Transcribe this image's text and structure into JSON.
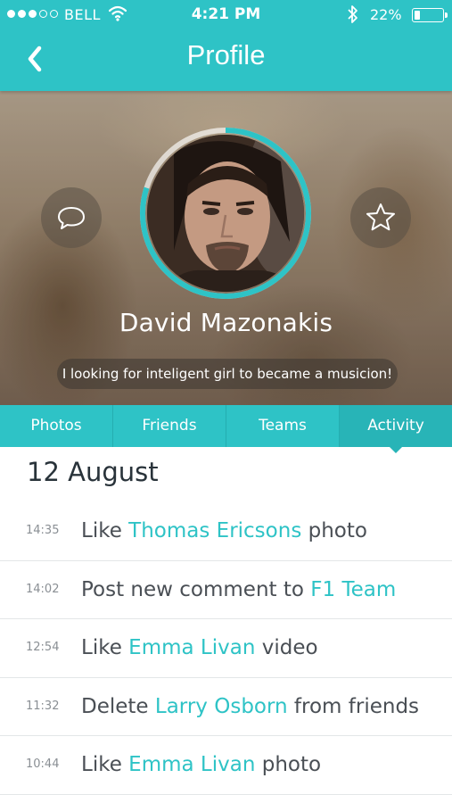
{
  "status_bar": {
    "carrier": "BELL",
    "time": "4:21 PM",
    "battery": "22%",
    "battery_level": 0.22,
    "signal_filled": 3,
    "signal_total": 5
  },
  "nav": {
    "title": "Profile"
  },
  "profile": {
    "name": "David Mazonakis",
    "status": "I looking for inteligent girl to became a musicion!"
  },
  "tabs": [
    {
      "label": "Photos"
    },
    {
      "label": "Friends"
    },
    {
      "label": "Teams"
    },
    {
      "label": "Activity",
      "active": true
    }
  ],
  "activity": {
    "date": "12 August",
    "items": [
      {
        "time": "14:35",
        "before": "Like ",
        "link": "Thomas Ericsons",
        "after": " photo"
      },
      {
        "time": "14:02",
        "before": "Post new comment to ",
        "link": "F1 Team",
        "after": ""
      },
      {
        "time": "12:54",
        "before": "Like ",
        "link": "Emma Livan",
        "after": " video"
      },
      {
        "time": "11:32",
        "before": "Delete ",
        "link": "Larry Osborn",
        "after": " from friends"
      },
      {
        "time": "10:44",
        "before": "Like ",
        "link": "Emma Livan",
        "after": " photo"
      }
    ]
  },
  "icons": {
    "back": "chevron-left-icon",
    "message": "speech-bubble-icon",
    "favorite": "star-icon",
    "wifi": "wifi-icon",
    "bluetooth": "bluetooth-icon"
  },
  "colors": {
    "accent": "#2ec3c6",
    "accent_dark": "#28b4b7",
    "text": "#4a4f55",
    "time_text": "#8a8f94"
  }
}
